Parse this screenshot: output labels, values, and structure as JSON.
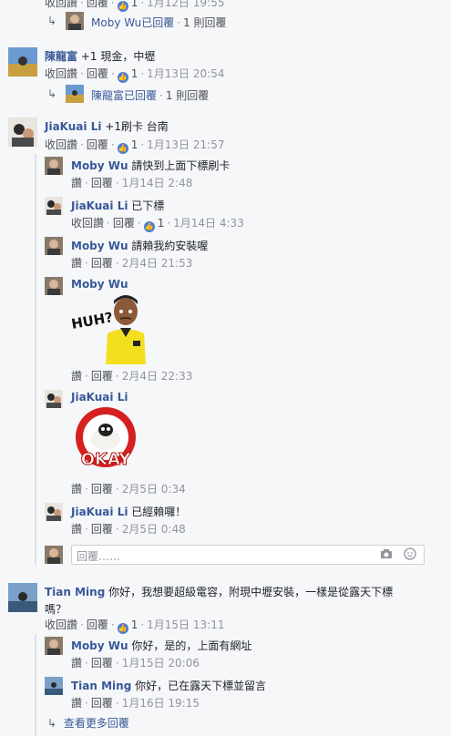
{
  "top_partial": {
    "meta_reply": "收回讚 · 回覆 · 1 · 1月12日 19:55",
    "reply_summary_name": "Moby Wu已回覆",
    "reply_summary_count": "1 則回覆"
  },
  "comments": [
    {
      "name": "陳龍富",
      "text": "+1 現金，中壢",
      "actions": {
        "unlike": "收回讚",
        "reply": "回覆",
        "likes": "1",
        "time": "1月13日 20:54"
      },
      "reply_summary": {
        "name": "陳龍富已回覆",
        "count": "1 則回覆"
      }
    },
    {
      "name": "JiaKuai Li",
      "text": "+1刷卡 台南",
      "actions": {
        "unlike": "收回讚",
        "reply": "回覆",
        "likes": "1",
        "time": "1月13日 21:57"
      },
      "replies": [
        {
          "name": "Moby Wu",
          "text": "請快到上面下標刷卡",
          "like": "讚",
          "reply": "回覆",
          "time": "1月14日 2:48"
        },
        {
          "name": "JiaKuai Li",
          "text": "已下標",
          "like": "收回讚",
          "reply": "回覆",
          "likes": "1",
          "time": "1月14日 4:33"
        },
        {
          "name": "Moby Wu",
          "text": "請賴我約安裝喔",
          "like": "讚",
          "reply": "回覆",
          "time": "2月4日 21:53"
        },
        {
          "name": "Moby Wu",
          "sticker": "HUH?",
          "like": "讚",
          "reply": "回覆",
          "time": "2月4日 22:33"
        },
        {
          "name": "JiaKuai Li",
          "sticker": "OKAY",
          "like": "讚",
          "reply": "回覆",
          "time": "2月5日 0:34"
        },
        {
          "name": "JiaKuai Li",
          "text": "已經賴囉！",
          "like": "讚",
          "reply": "回覆",
          "time": "2月5日 0:48"
        }
      ],
      "reply_input_placeholder": "回覆……"
    },
    {
      "name": "Tian Ming",
      "text_line1": "你好，我想要超級電容，附現中壢安裝，一樣是從露天下標",
      "text_line2": "嗎？",
      "actions": {
        "unlike": "收回讚",
        "reply": "回覆",
        "likes": "1",
        "time": "1月15日 13:11"
      },
      "replies": [
        {
          "name": "Moby Wu",
          "text": "你好，是的，上面有網址",
          "like": "讚",
          "reply": "回覆",
          "time": "1月15日 20:06"
        },
        {
          "name": "Tian Ming",
          "text": "你好，已在露天下標並留言",
          "like": "讚",
          "reply": "回覆",
          "time": "1月16日 19:15"
        }
      ],
      "more_replies": "查看更多回覆"
    }
  ],
  "colors": {
    "name": "#385898",
    "like_icon": "#4a7cd4",
    "background": "#f6f7f9"
  }
}
